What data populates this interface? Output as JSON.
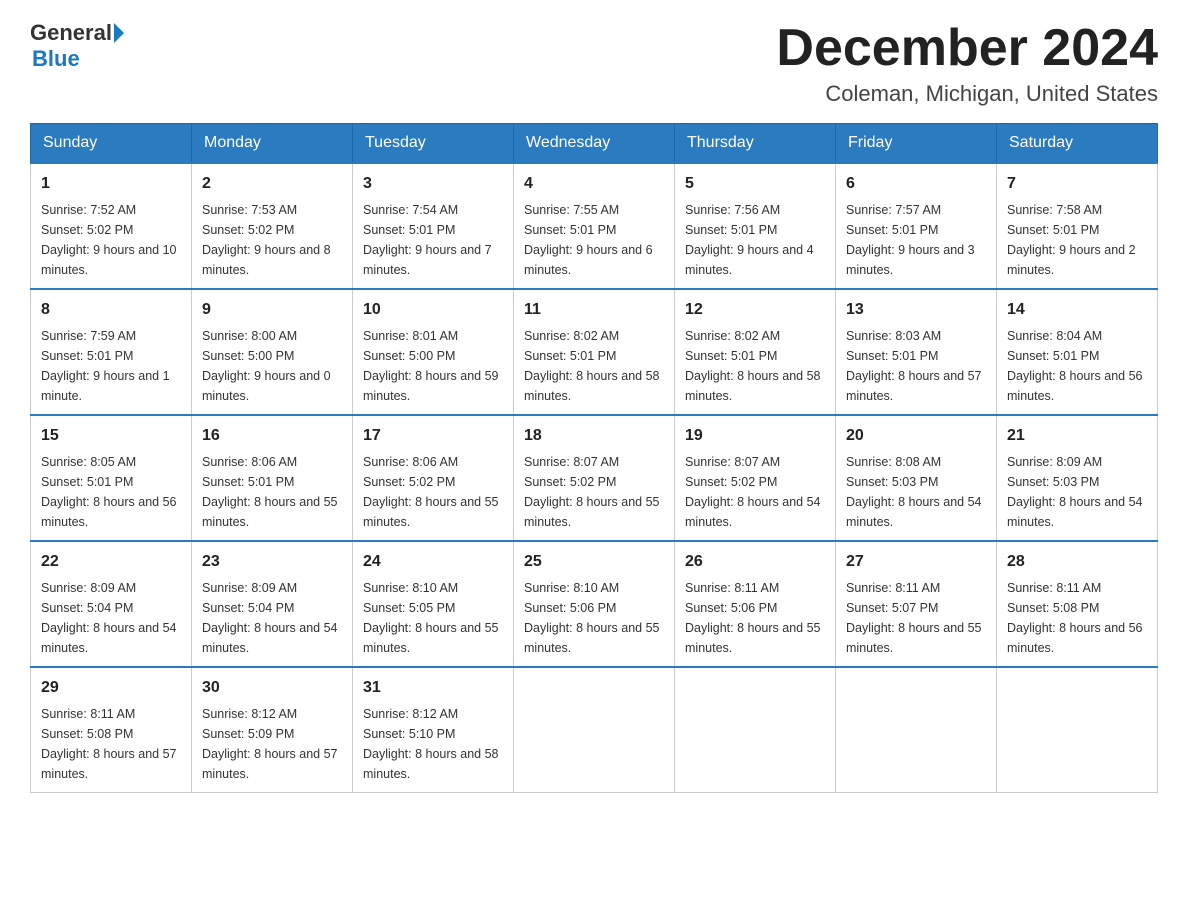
{
  "header": {
    "logo_general": "General",
    "logo_blue": "Blue",
    "month_title": "December 2024",
    "location": "Coleman, Michigan, United States"
  },
  "days_of_week": [
    "Sunday",
    "Monday",
    "Tuesday",
    "Wednesday",
    "Thursday",
    "Friday",
    "Saturday"
  ],
  "weeks": [
    [
      {
        "day": "1",
        "sunrise": "7:52 AM",
        "sunset": "5:02 PM",
        "daylight": "9 hours and 10 minutes."
      },
      {
        "day": "2",
        "sunrise": "7:53 AM",
        "sunset": "5:02 PM",
        "daylight": "9 hours and 8 minutes."
      },
      {
        "day": "3",
        "sunrise": "7:54 AM",
        "sunset": "5:01 PM",
        "daylight": "9 hours and 7 minutes."
      },
      {
        "day": "4",
        "sunrise": "7:55 AM",
        "sunset": "5:01 PM",
        "daylight": "9 hours and 6 minutes."
      },
      {
        "day": "5",
        "sunrise": "7:56 AM",
        "sunset": "5:01 PM",
        "daylight": "9 hours and 4 minutes."
      },
      {
        "day": "6",
        "sunrise": "7:57 AM",
        "sunset": "5:01 PM",
        "daylight": "9 hours and 3 minutes."
      },
      {
        "day": "7",
        "sunrise": "7:58 AM",
        "sunset": "5:01 PM",
        "daylight": "9 hours and 2 minutes."
      }
    ],
    [
      {
        "day": "8",
        "sunrise": "7:59 AM",
        "sunset": "5:01 PM",
        "daylight": "9 hours and 1 minute."
      },
      {
        "day": "9",
        "sunrise": "8:00 AM",
        "sunset": "5:00 PM",
        "daylight": "9 hours and 0 minutes."
      },
      {
        "day": "10",
        "sunrise": "8:01 AM",
        "sunset": "5:00 PM",
        "daylight": "8 hours and 59 minutes."
      },
      {
        "day": "11",
        "sunrise": "8:02 AM",
        "sunset": "5:01 PM",
        "daylight": "8 hours and 58 minutes."
      },
      {
        "day": "12",
        "sunrise": "8:02 AM",
        "sunset": "5:01 PM",
        "daylight": "8 hours and 58 minutes."
      },
      {
        "day": "13",
        "sunrise": "8:03 AM",
        "sunset": "5:01 PM",
        "daylight": "8 hours and 57 minutes."
      },
      {
        "day": "14",
        "sunrise": "8:04 AM",
        "sunset": "5:01 PM",
        "daylight": "8 hours and 56 minutes."
      }
    ],
    [
      {
        "day": "15",
        "sunrise": "8:05 AM",
        "sunset": "5:01 PM",
        "daylight": "8 hours and 56 minutes."
      },
      {
        "day": "16",
        "sunrise": "8:06 AM",
        "sunset": "5:01 PM",
        "daylight": "8 hours and 55 minutes."
      },
      {
        "day": "17",
        "sunrise": "8:06 AM",
        "sunset": "5:02 PM",
        "daylight": "8 hours and 55 minutes."
      },
      {
        "day": "18",
        "sunrise": "8:07 AM",
        "sunset": "5:02 PM",
        "daylight": "8 hours and 55 minutes."
      },
      {
        "day": "19",
        "sunrise": "8:07 AM",
        "sunset": "5:02 PM",
        "daylight": "8 hours and 54 minutes."
      },
      {
        "day": "20",
        "sunrise": "8:08 AM",
        "sunset": "5:03 PM",
        "daylight": "8 hours and 54 minutes."
      },
      {
        "day": "21",
        "sunrise": "8:09 AM",
        "sunset": "5:03 PM",
        "daylight": "8 hours and 54 minutes."
      }
    ],
    [
      {
        "day": "22",
        "sunrise": "8:09 AM",
        "sunset": "5:04 PM",
        "daylight": "8 hours and 54 minutes."
      },
      {
        "day": "23",
        "sunrise": "8:09 AM",
        "sunset": "5:04 PM",
        "daylight": "8 hours and 54 minutes."
      },
      {
        "day": "24",
        "sunrise": "8:10 AM",
        "sunset": "5:05 PM",
        "daylight": "8 hours and 55 minutes."
      },
      {
        "day": "25",
        "sunrise": "8:10 AM",
        "sunset": "5:06 PM",
        "daylight": "8 hours and 55 minutes."
      },
      {
        "day": "26",
        "sunrise": "8:11 AM",
        "sunset": "5:06 PM",
        "daylight": "8 hours and 55 minutes."
      },
      {
        "day": "27",
        "sunrise": "8:11 AM",
        "sunset": "5:07 PM",
        "daylight": "8 hours and 55 minutes."
      },
      {
        "day": "28",
        "sunrise": "8:11 AM",
        "sunset": "5:08 PM",
        "daylight": "8 hours and 56 minutes."
      }
    ],
    [
      {
        "day": "29",
        "sunrise": "8:11 AM",
        "sunset": "5:08 PM",
        "daylight": "8 hours and 57 minutes."
      },
      {
        "day": "30",
        "sunrise": "8:12 AM",
        "sunset": "5:09 PM",
        "daylight": "8 hours and 57 minutes."
      },
      {
        "day": "31",
        "sunrise": "8:12 AM",
        "sunset": "5:10 PM",
        "daylight": "8 hours and 58 minutes."
      },
      null,
      null,
      null,
      null
    ]
  ],
  "labels": {
    "sunrise": "Sunrise:",
    "sunset": "Sunset:",
    "daylight": "Daylight:"
  }
}
